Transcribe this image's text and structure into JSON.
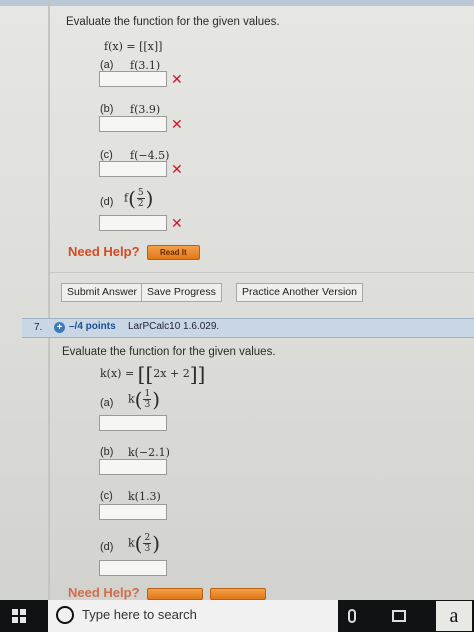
{
  "question6": {
    "prompt": "Evaluate the function for the given values.",
    "function": "f(x) = [[x]]",
    "parts": [
      {
        "label": "(a)",
        "expr": "f(3.1)",
        "answer": "",
        "status": "incorrect"
      },
      {
        "label": "(b)",
        "expr": "f(3.9)",
        "answer": "",
        "status": "incorrect"
      },
      {
        "label": "(c)",
        "expr": "f(−4.5)",
        "answer": "",
        "status": "incorrect"
      },
      {
        "label": "(d)",
        "fn": "f",
        "frac_num": "5",
        "frac_den": "2",
        "answer": "",
        "status": "incorrect"
      }
    ],
    "mark": "✕",
    "need_help": "Need Help?",
    "read_it": "Read It"
  },
  "actions": {
    "submit": "Submit Answer",
    "save": "Save Progress",
    "practice": "Practice Another Version"
  },
  "question7": {
    "number": "7.",
    "points": "–/4 points",
    "source": "LarPCalc10 1.6.029.",
    "prompt": "Evaluate the function for the given values.",
    "function_lhs": "k(x) =",
    "function_inner": "2x + 2",
    "parts": [
      {
        "label": "(a)",
        "fn": "k",
        "frac_num": "1",
        "frac_den": "3",
        "answer": ""
      },
      {
        "label": "(b)",
        "expr": "k(−2.1)",
        "answer": ""
      },
      {
        "label": "(c)",
        "expr": "k(1.3)",
        "answer": ""
      },
      {
        "label": "(d)",
        "fn": "k",
        "frac_num": "2",
        "frac_den": "3",
        "answer": ""
      }
    ],
    "need_help": "Need Help?"
  },
  "taskbar": {
    "search_placeholder": "Type here to search",
    "app_letter": "a"
  }
}
